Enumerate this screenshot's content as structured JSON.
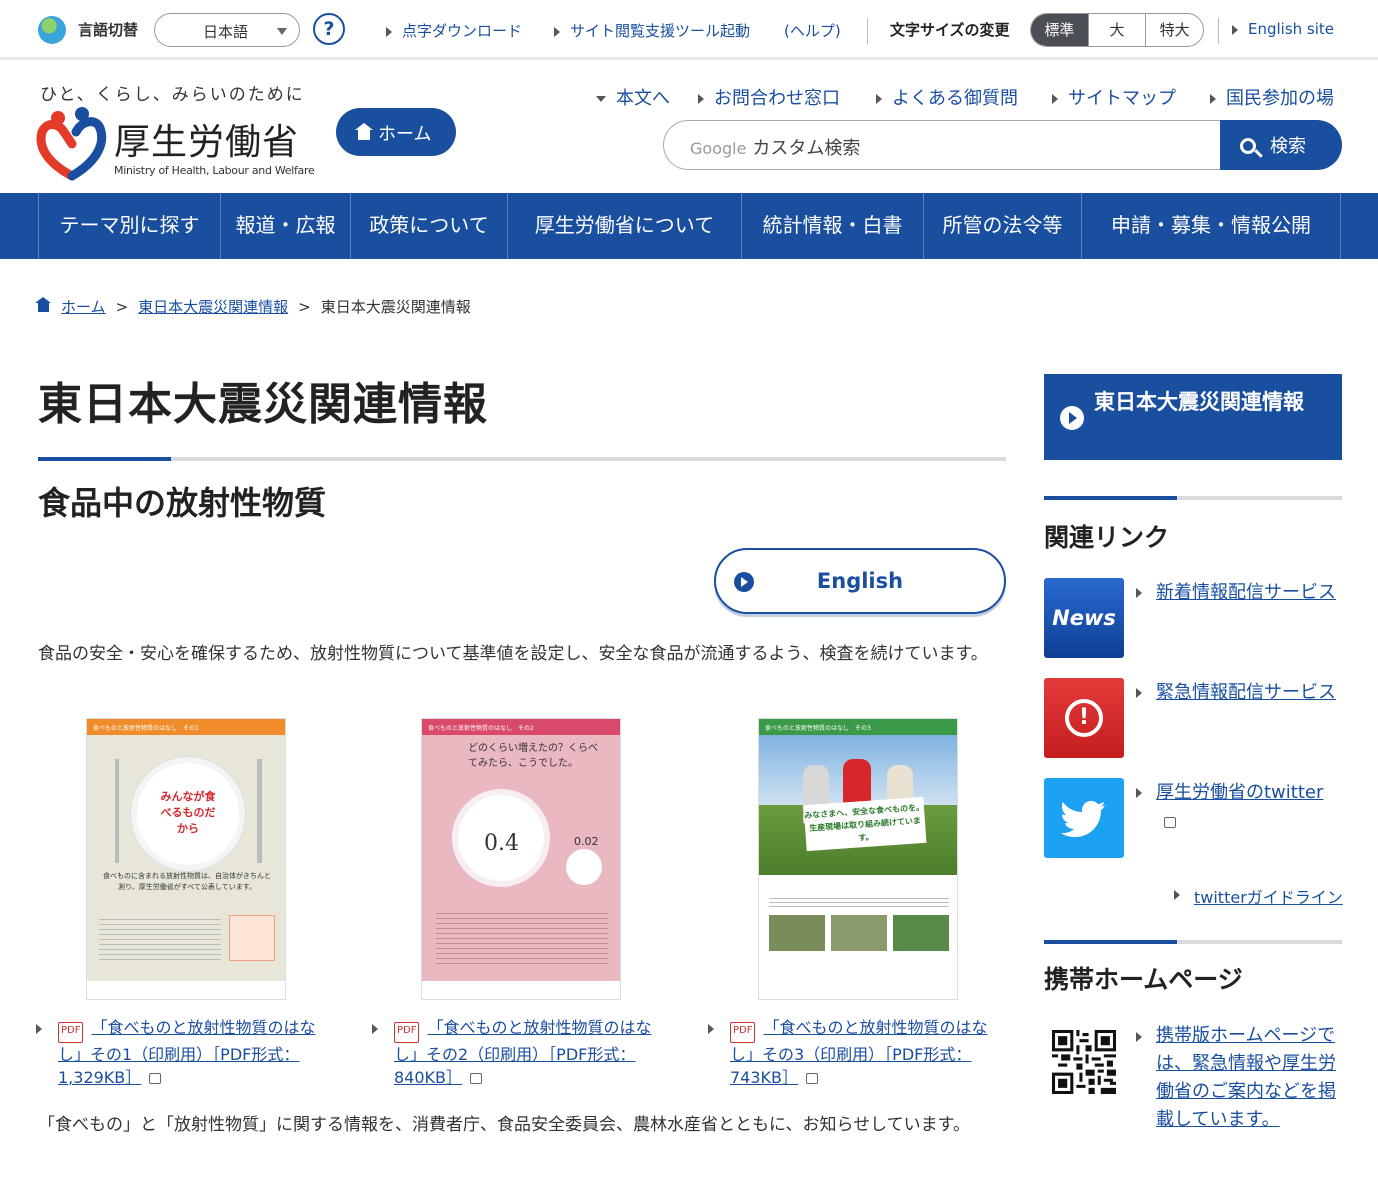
{
  "util": {
    "lang_label": "言語切替",
    "lang_value": "日本語",
    "help": "?",
    "links": [
      "点字ダウンロード",
      "サイト閲覧支援ツール起動",
      "(ヘルプ)"
    ],
    "font_size_label": "文字サイズの変更",
    "font_sizes": [
      "標準",
      "大",
      "特大"
    ],
    "english_site": "English site"
  },
  "header": {
    "tagline": "ひと、くらし、みらいのために",
    "logo_text": "厚生労働省",
    "logo_sub": "Ministry of Health, Labour and Welfare",
    "home": "ホーム",
    "links": [
      "本文へ",
      "お問合わせ窓口",
      "よくある御質問",
      "サイトマップ",
      "国民参加の場"
    ],
    "search_google": "Google",
    "search_placeholder": "カスタム検索",
    "search_button": "検索"
  },
  "nav": [
    "テーマ別に探す",
    "報道・広報",
    "政策について",
    "厚生労働省について",
    "統計情報・白書",
    "所管の法令等",
    "申請・募集・情報公開"
  ],
  "breadcrumb": [
    "ホーム",
    "東日本大震災関連情報",
    "東日本大震災関連情報"
  ],
  "main": {
    "title": "東日本大震災関連情報",
    "subtitle": "食品中の放射性物質",
    "english_button": "English",
    "intro": "食品の安全・安心を確保するため、放射性物質について基準値を設定し、安全な食品が流通するよう、検査を続けています。",
    "outro": "「食べもの」と「放射性物質」に関する情報を、消費者庁、食品安全委員会、農林水産省とともに、お知らせしています。",
    "posters": [
      {
        "pdf": "PDF",
        "link": "「食べものと放射性物質のはなし」その1（印刷用）［PDF形式：1,329KB］",
        "header": "食べものと放射性物質のはなし　その1",
        "headline": "みんなが食べるものだから",
        "body": "食べものに含まれる放射性物質は、自治体がきちんと測り、厚生労働省がすべて公表しています。"
      },
      {
        "pdf": "PDF",
        "link": "「食べものと放射性物質のはなし」その2（印刷用）［PDF形式：840KB］",
        "header": "食べものと放射性物質のはなし　その2",
        "headline": "どのくらい増えたの？くらべてみたら、こうでした。",
        "value_a": "0.4",
        "value_b": "0.02"
      },
      {
        "pdf": "PDF",
        "link": "「食べものと放射性物質のはなし」その3（印刷用）［PDF形式：743KB］",
        "header": "食べものと放射性物質のはなし　その3",
        "headline": "みなさまへ、安全な食べものを。生産現場は取り組み続けています。"
      }
    ]
  },
  "sidebar": {
    "heading": "東日本大震災関連情報",
    "related_title": "関連リンク",
    "links": [
      {
        "icon": "News",
        "label": "新着情報配信サービス"
      },
      {
        "icon": "!",
        "label": "緊急情報配信サービス"
      },
      {
        "icon": "twitter-icon",
        "label": "厚生労働省のtwitter"
      }
    ],
    "twitter_guide": "twitterガイドライン",
    "mobile_title": "携帯ホームページ",
    "mobile_text": "携帯版ホームページでは、緊急情報や厚生労働省のご案内などを掲載しています。"
  },
  "colors": {
    "primary": "#1a4fa0",
    "accent_red": "#d7272b",
    "twitter": "#1da1f2"
  }
}
